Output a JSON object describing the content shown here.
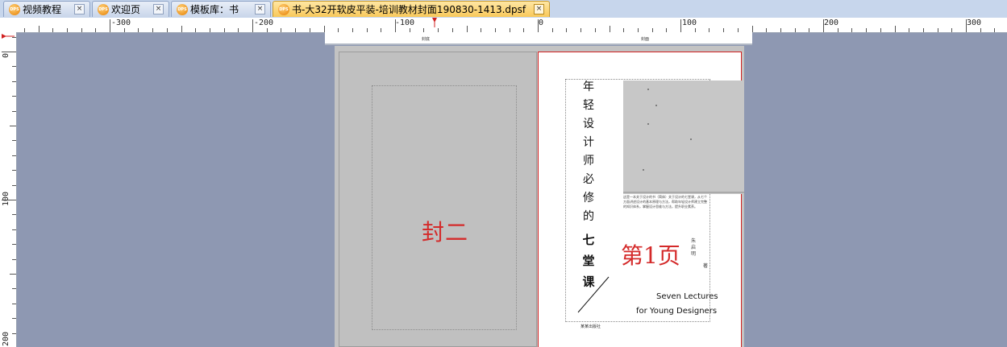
{
  "tabs": [
    {
      "label": "视频教程",
      "icon": "dps-icon",
      "active": false
    },
    {
      "label": "欢迎页",
      "icon": "dps-icon",
      "active": false
    },
    {
      "label": "模板库：书",
      "icon": "dps-icon",
      "active": false
    },
    {
      "label": "书-大32开软皮平装-培训教材封面190830-1413.dpsf",
      "icon": "dps-icon",
      "active": true
    }
  ],
  "ruler": {
    "h_labels": [
      "-300",
      "-200",
      "-100",
      "0",
      "100",
      "200",
      "300"
    ],
    "v_labels": [
      "0",
      "100",
      "200"
    ]
  },
  "guide_labels": [
    "封底",
    "封面"
  ],
  "page": {
    "left_label": "封二",
    "right_label": "第1页",
    "vertical_title": [
      "年",
      "轻",
      "设",
      "计",
      "师",
      "必",
      "修",
      "的"
    ],
    "vertical_title_bold": [
      "七",
      "堂",
      "课"
    ],
    "paragraph": "这是一本关于设计的书（简体）关于设计的七堂课，从七个方面讲述设计的基本原理与方法，帮助年轻设计师建立完整的知识体系，掌握设计思维与方法，提升职业素养。",
    "author": "朱启明",
    "author_suffix": "著",
    "english_line1": "Seven Lectures",
    "english_line2": "for Young Designers",
    "publisher": "某某出版社"
  },
  "colors": {
    "accent_red": "#d42a2a",
    "tab_active": "#f8c85a",
    "workspace": "#8e98b2"
  }
}
